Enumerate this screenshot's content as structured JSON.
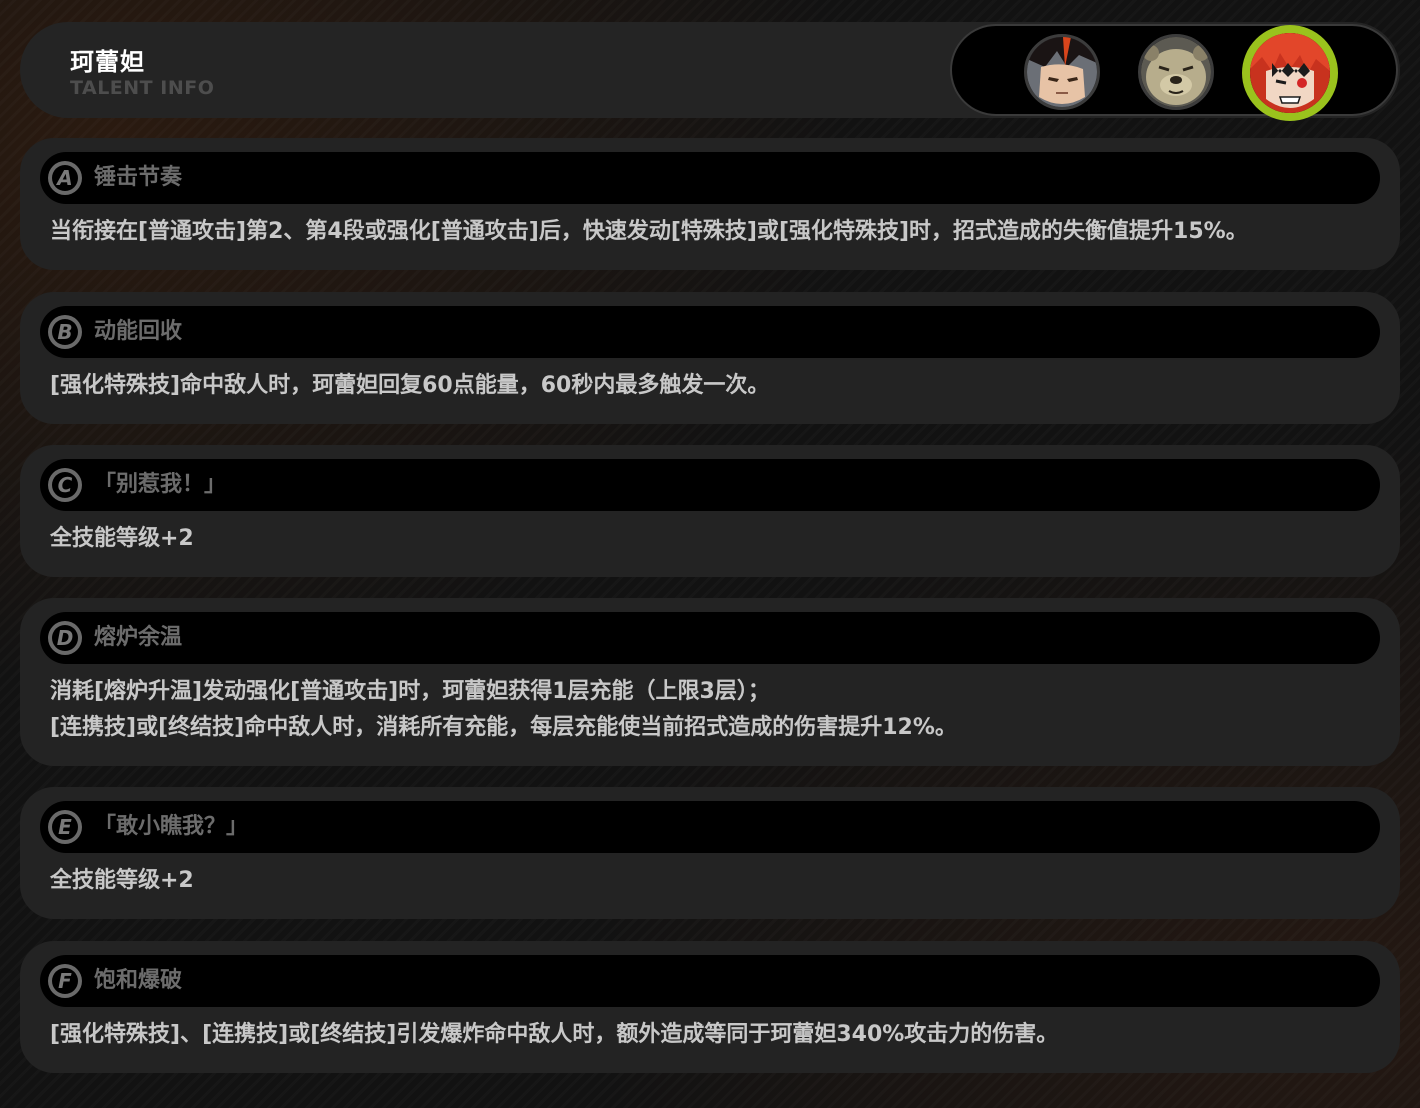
{
  "header": {
    "title": "珂蕾妲",
    "subtitle": "TALENT INFO",
    "avatars": [
      {
        "name": "character-1-avatar",
        "selected": false
      },
      {
        "name": "character-2-avatar",
        "selected": false
      },
      {
        "name": "character-3-avatar",
        "selected": true
      }
    ],
    "accent_color": "#9ac21d"
  },
  "talents": [
    {
      "badge": "A",
      "title": "锤击节奏",
      "lines": [
        "当衔接在[普通攻击]第2、第4段或强化[普通攻击]后，快速发动[特殊技]或[强化特殊技]时，招式造成的失衡值提升15%。"
      ]
    },
    {
      "badge": "B",
      "title": "动能回收",
      "lines": [
        "[强化特殊技]命中敌人时，珂蕾妲回复60点能量，60秒内最多触发一次。"
      ]
    },
    {
      "badge": "C",
      "title": "「别惹我！」",
      "lines": [
        "全技能等级+2"
      ]
    },
    {
      "badge": "D",
      "title": "熔炉余温",
      "lines": [
        "消耗[熔炉升温]发动强化[普通攻击]时，珂蕾妲获得1层充能（上限3层）；",
        "[连携技]或[终结技]命中敌人时，消耗所有充能，每层充能使当前招式造成的伤害提升12%。"
      ]
    },
    {
      "badge": "E",
      "title": "「敢小瞧我？」",
      "lines": [
        "全技能等级+2"
      ]
    },
    {
      "badge": "F",
      "title": "饱和爆破",
      "lines": [
        "[强化特殊技]、[连携技]或[终结技]引发爆炸命中敌人时，额外造成等同于珂蕾妲340%攻击力的伤害。"
      ]
    }
  ]
}
